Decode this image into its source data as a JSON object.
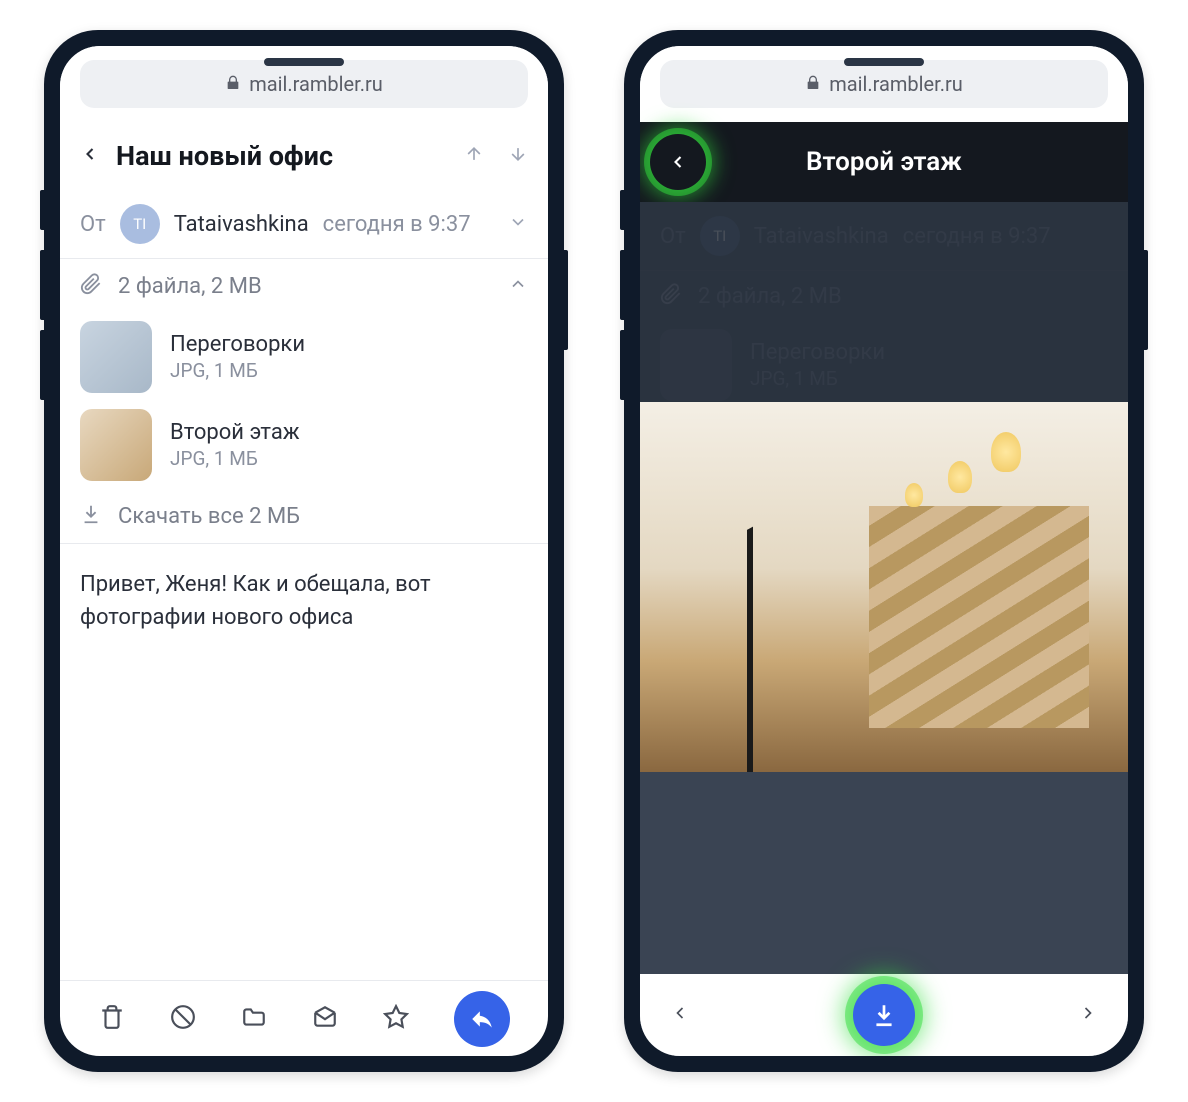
{
  "url": "mail.rambler.ru",
  "email": {
    "subject": "Наш новый офис",
    "from_label": "От",
    "sender": {
      "initials": "TI",
      "name": "Tataivashkina",
      "time": "сегодня в 9:37"
    },
    "attachments": {
      "summary": "2 файла, 2 MB",
      "files": [
        {
          "name": "Переговорки",
          "meta": "JPG, 1 МБ"
        },
        {
          "name": "Второй этаж",
          "meta": "JPG, 1 МБ"
        }
      ],
      "download_all": "Скачать все 2 МБ"
    },
    "body": "Привет, Женя! Как и обещала, вот фотографии нового офиса"
  },
  "viewer": {
    "title": "Второй этаж"
  }
}
